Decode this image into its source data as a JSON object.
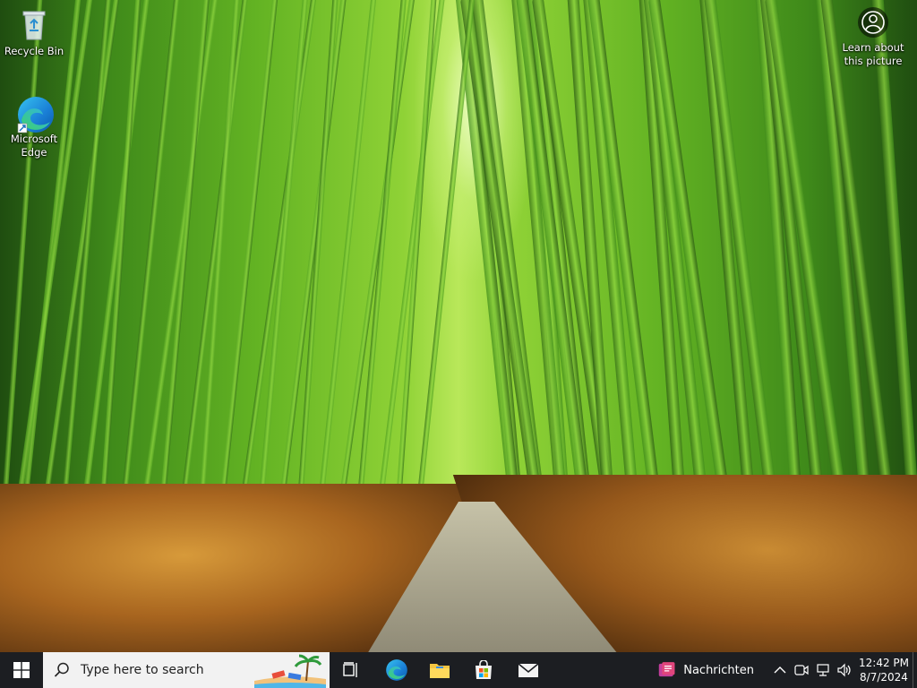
{
  "desktop": {
    "icons": [
      {
        "label": "Recycle Bin"
      },
      {
        "label_line1": "Microsoft",
        "label_line2": "Edge"
      }
    ],
    "learn_about": {
      "line1": "Learn about",
      "line2": "this picture"
    }
  },
  "taskbar": {
    "start_icon": "windows-logo-icon",
    "search": {
      "placeholder": "Type here to search"
    },
    "pinned": [
      "task-view-icon",
      "edge-icon",
      "file-explorer-icon",
      "store-icon",
      "mail-icon"
    ],
    "news": {
      "label": "Nachrichten"
    },
    "tray": {
      "icons": [
        "chevron-up-icon",
        "meet-icon",
        "network-icon",
        "volume-icon"
      ],
      "time": "12:42 PM",
      "date": "8/7/2024"
    }
  },
  "colors": {
    "taskbar_bg": "#1c1e22",
    "search_bg": "#f2f2f2",
    "accent": "#0078d4"
  }
}
